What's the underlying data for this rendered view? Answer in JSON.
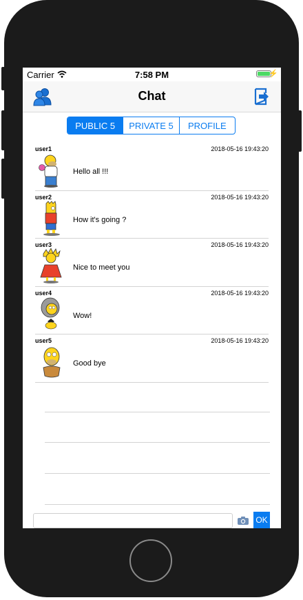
{
  "statusbar": {
    "carrier": "Carrier",
    "time": "7:58 PM",
    "battery_level": 1.0,
    "wifi_icon": "wifi-icon",
    "battery_icon": "battery-icon"
  },
  "navbar": {
    "title": "Chat",
    "left_icon": "users-icon",
    "right_icon": "logout-icon"
  },
  "tabs": [
    {
      "label": "PUBLIC 5",
      "active": true
    },
    {
      "label": "PRIVATE 5",
      "active": false
    },
    {
      "label": "PROFILE",
      "active": false
    }
  ],
  "messages": [
    {
      "user": "user1",
      "time": "2018-05-16 19:43:20",
      "text": "Hello all !!!"
    },
    {
      "user": "user2",
      "time": "2018-05-16 19:43:20",
      "text": "How it's going ?"
    },
    {
      "user": "user3",
      "time": "2018-05-16 19:43:20",
      "text": "Nice to meet you"
    },
    {
      "user": "user4",
      "time": "2018-05-16 19:43:20",
      "text": "Wow!"
    },
    {
      "user": "user5",
      "time": "2018-05-16 19:43:20",
      "text": "Good bye"
    }
  ],
  "input": {
    "placeholder": "",
    "value": "",
    "send_label": "OK",
    "camera_icon": "camera-icon"
  },
  "colors": {
    "accent": "#0a7cf0",
    "phone_body": "#1b1b1b",
    "battery": "#4cd964"
  }
}
